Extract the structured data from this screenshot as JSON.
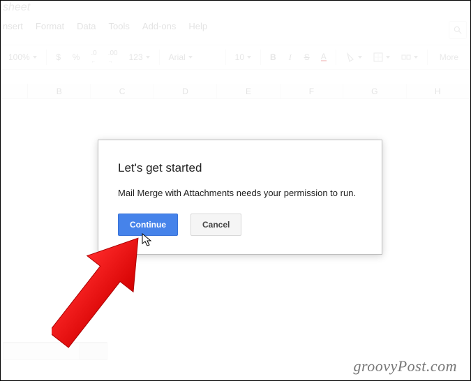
{
  "doc": {
    "title_fragment": "sheet"
  },
  "menubar": {
    "items": [
      "nsert",
      "Format",
      "Data",
      "Tools",
      "Add-ons",
      "Help"
    ]
  },
  "toolbar": {
    "zoom": "100%",
    "currency": "$",
    "percent": "%",
    "dec_dec": ".0",
    "dec_inc": ".00",
    "numfmt": "123",
    "font": "Arial",
    "size": "10",
    "more": "More"
  },
  "columns": [
    "B",
    "C",
    "D",
    "E",
    "F",
    "G",
    "H"
  ],
  "dialog": {
    "title": "Let's get started",
    "body": "Mail Merge with Attachments needs your permission to run.",
    "primary": "Continue",
    "secondary": "Cancel"
  },
  "watermark": "groovyPost.com"
}
